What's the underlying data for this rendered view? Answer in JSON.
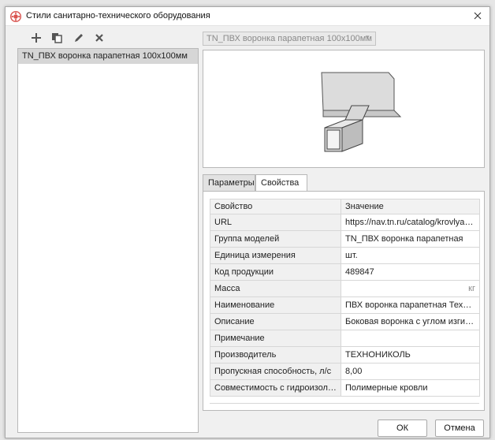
{
  "window": {
    "title": "Стили санитарно-технического оборудования",
    "accent_color": "#d9534f"
  },
  "toolbar": {
    "buttons": [
      {
        "name": "add-button",
        "icon": "plus-icon"
      },
      {
        "name": "copy-button",
        "icon": "copy-icon"
      },
      {
        "name": "edit-button",
        "icon": "pencil-icon"
      },
      {
        "name": "delete-button",
        "icon": "x-icon"
      }
    ]
  },
  "styles_list": {
    "items": [
      "TN_ПВХ воронка парапетная 100x100мм"
    ],
    "selected_index": 0
  },
  "style_select": {
    "value": "TN_ПВХ воронка парапетная 100x100мм"
  },
  "tabs": [
    {
      "label": "Параметры",
      "active": false
    },
    {
      "label": "Свойства",
      "active": true
    }
  ],
  "properties": {
    "headers": {
      "key": "Свойство",
      "value": "Значение"
    },
    "rows": [
      {
        "key": "URL",
        "value": "https://nav.tn.ru/catalog/krovlya/k..."
      },
      {
        "key": "Группа моделей",
        "value": "TN_ПВХ воронка парапетная"
      },
      {
        "key": "Единица измерения",
        "value": "шт."
      },
      {
        "key": "Код продукции",
        "value": "489847"
      },
      {
        "key": "Масса",
        "value": "",
        "unit": "кг"
      },
      {
        "key": "Наименование",
        "value": "ПВХ воронка парапетная ТехноН..."
      },
      {
        "key": "Описание",
        "value": "Боковая воронка с углом изгиба 9..."
      },
      {
        "key": "Примечание",
        "value": ""
      },
      {
        "key": "Производитель",
        "value": "ТЕХНОНИКОЛЬ"
      },
      {
        "key": "Пропускная способность, л/с",
        "value": "8,00"
      },
      {
        "key": "Совместимость с гидроизоляци...",
        "value": "Полимерные кровли"
      }
    ]
  },
  "footer": {
    "ok_label": "ОК",
    "cancel_label": "Отмена"
  }
}
